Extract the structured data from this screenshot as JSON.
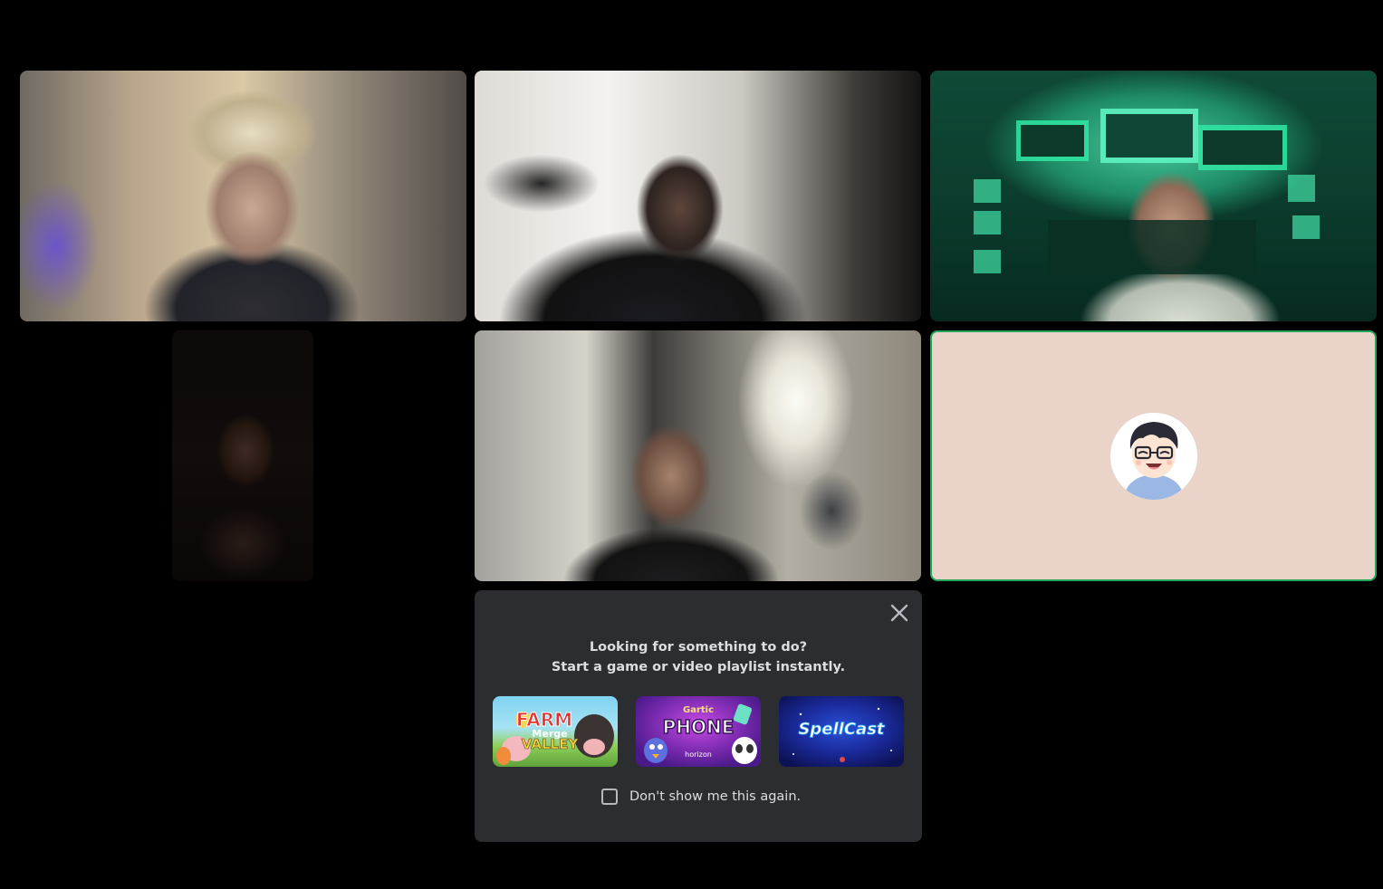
{
  "activity_prompt": {
    "line_1": "Looking for something to do?",
    "line_2": "Start a game or video playlist instantly.",
    "activities": [
      {
        "name": "Farm Merge Valley",
        "title": "FARM",
        "subtitle": "Merge",
        "subtitle_2": "VALLEY"
      },
      {
        "name": "Gartic Phone",
        "title": "PHONE",
        "brand": "Gartic",
        "publisher": "horizon"
      },
      {
        "name": "SpellCast",
        "title": "SpellCast"
      }
    ],
    "checkbox_label": "Don't show me this again.",
    "checkbox_checked": false
  },
  "participants": [
    {
      "video": true
    },
    {
      "video": true
    },
    {
      "video": true
    },
    {
      "video": true
    },
    {
      "video": true
    },
    {
      "video": false,
      "speaking": true
    }
  ],
  "colors": {
    "background": "#000000",
    "panel": "#2b2d31",
    "speaking_border": "#23a55a",
    "avatar_tile": "#ead4c9"
  }
}
